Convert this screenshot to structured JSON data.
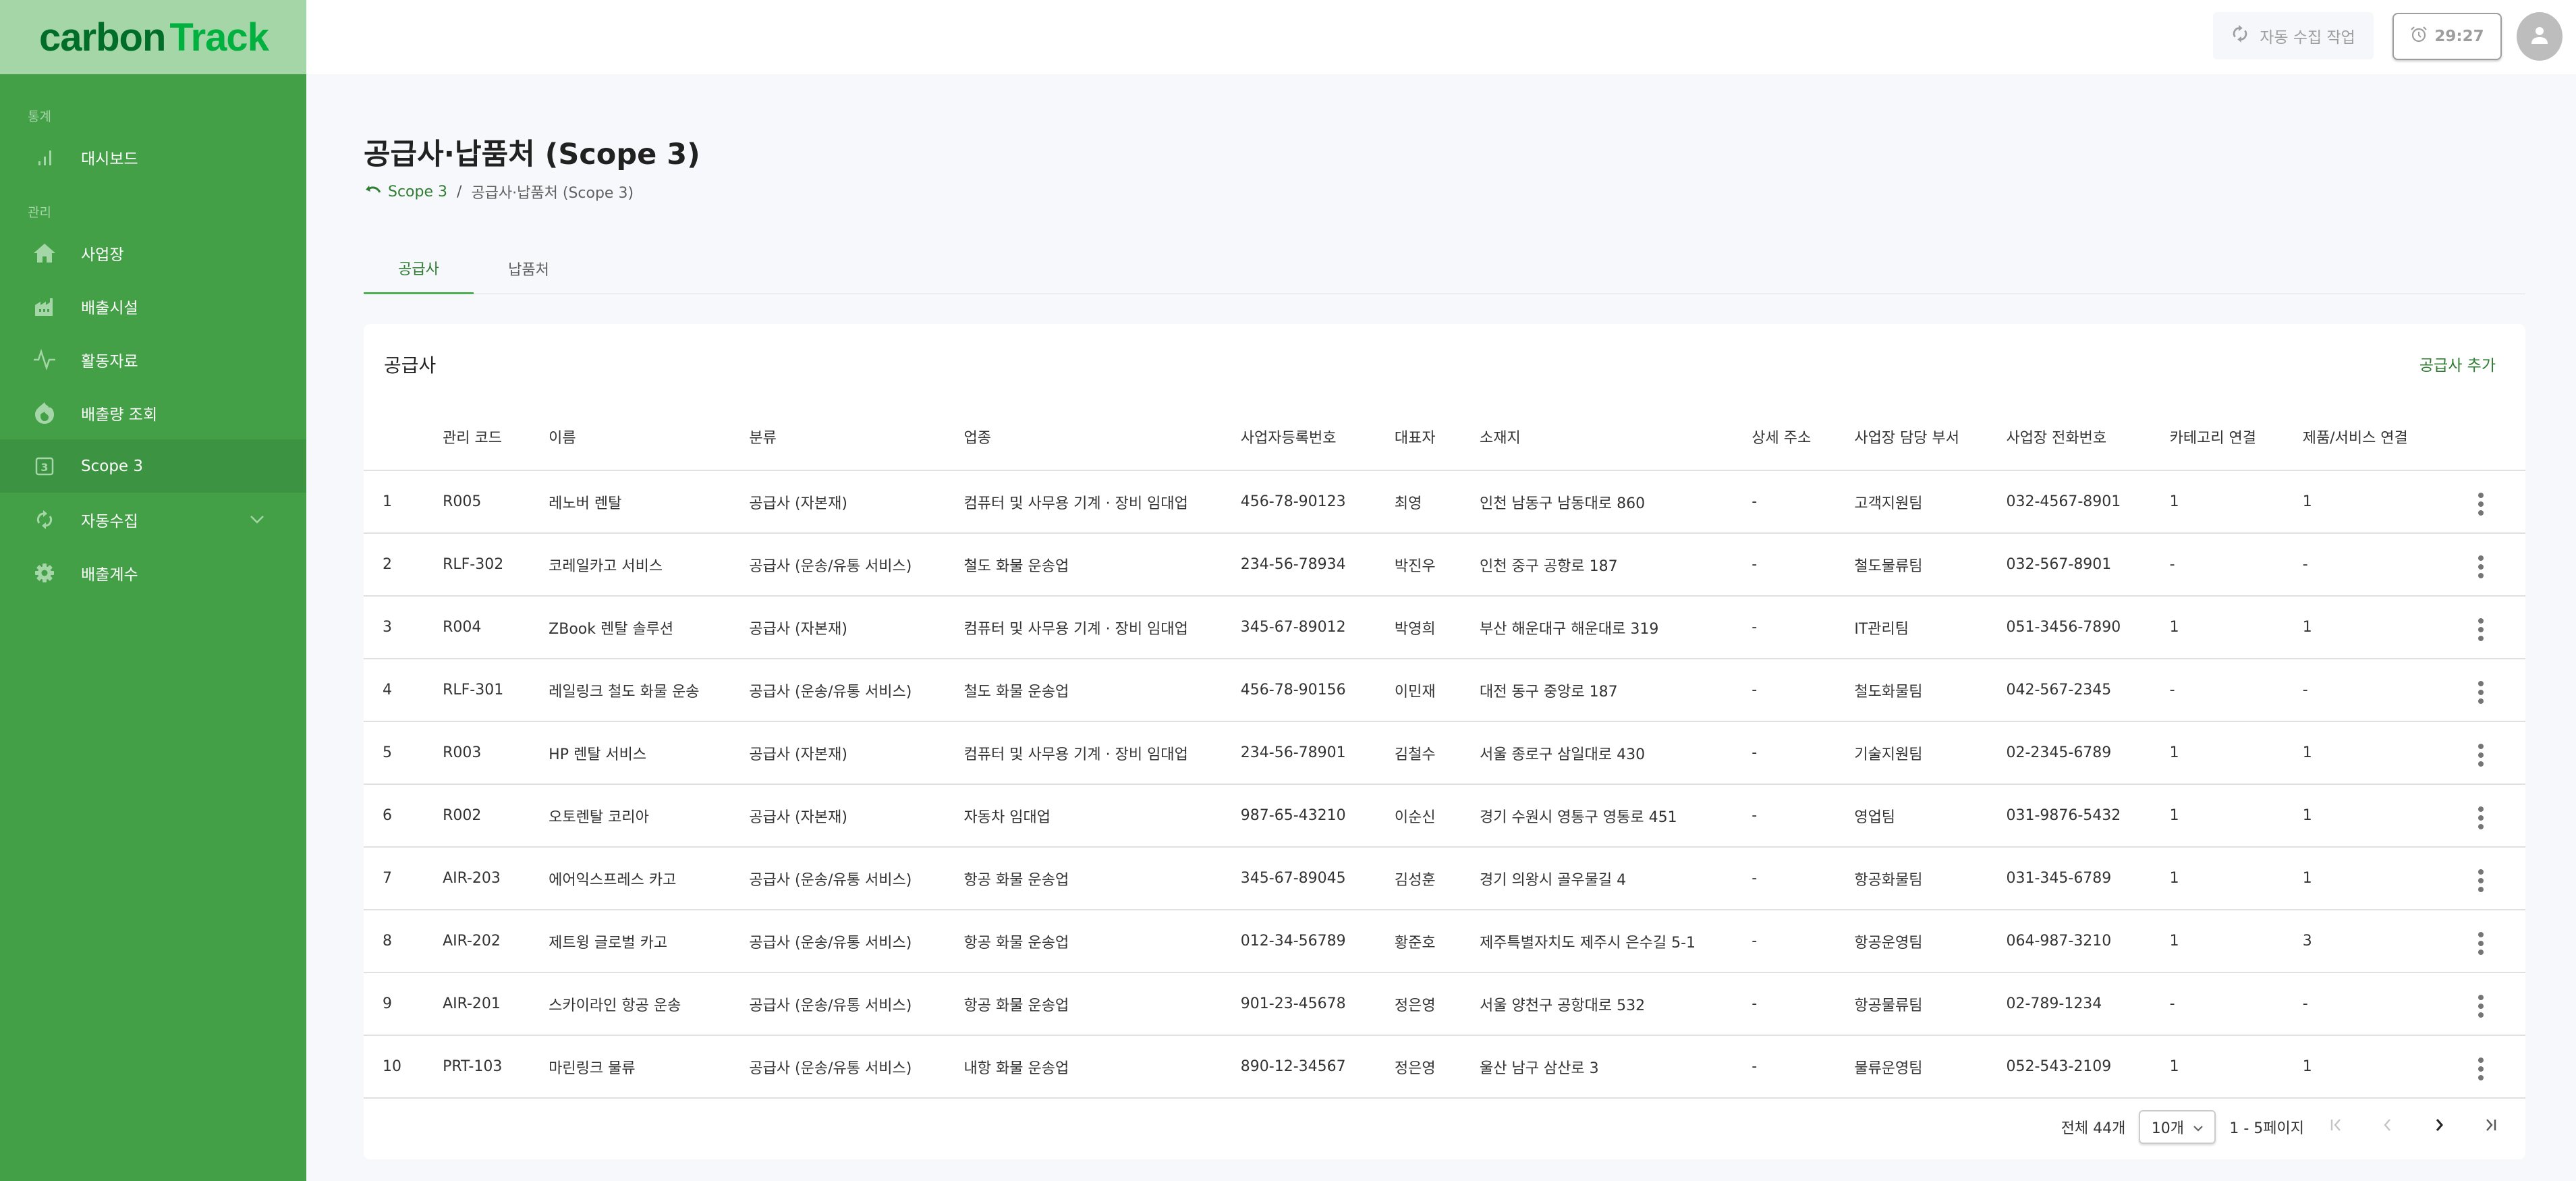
{
  "app": {
    "logo_part1": "carbon",
    "logo_part2": "Track"
  },
  "sidebar": {
    "sections": [
      {
        "label": "통계"
      },
      {
        "label": "관리"
      }
    ],
    "items": [
      {
        "label": "대시보드",
        "icon": "bar-chart-icon"
      },
      {
        "label": "사업장",
        "icon": "home-icon"
      },
      {
        "label": "배출시설",
        "icon": "factory-icon"
      },
      {
        "label": "활동자료",
        "icon": "activity-icon"
      },
      {
        "label": "배출량 조회",
        "icon": "fire-icon"
      },
      {
        "label": "Scope 3",
        "icon": "scope3-icon",
        "active": true
      },
      {
        "label": "자동수집",
        "icon": "sync-icon",
        "expandable": true
      },
      {
        "label": "배출계수",
        "icon": "gear-icon"
      }
    ]
  },
  "topbar": {
    "auto_collect_label": "자동 수집 작업",
    "timer": "29:27"
  },
  "page": {
    "title": "공급사·납품처 (Scope 3)",
    "breadcrumb_link": "Scope 3",
    "breadcrumb_sep": "/",
    "breadcrumb_current": "공급사·납품처 (Scope 3)",
    "tabs": [
      {
        "label": "공급사",
        "active": true
      },
      {
        "label": "납품처",
        "active": false
      }
    ]
  },
  "card": {
    "title": "공급사",
    "add_label": "공급사 추가"
  },
  "table": {
    "columns": [
      "",
      "관리 코드",
      "이름",
      "분류",
      "업종",
      "사업자등록번호",
      "대표자",
      "소재지",
      "상세 주소",
      "사업장 담당 부서",
      "사업장 전화번호",
      "카테고리 연결",
      "제품/서비스 연결",
      ""
    ],
    "rows": [
      [
        "1",
        "R005",
        "레노버 렌탈",
        "공급사 (자본재)",
        "컴퓨터 및 사무용 기계 · 장비 임대업",
        "456-78-90123",
        "최영",
        "인천 남동구 남동대로 860",
        "-",
        "고객지원팀",
        "032-4567-8901",
        "1",
        "1"
      ],
      [
        "2",
        "RLF-302",
        "코레일카고 서비스",
        "공급사 (운송/유통 서비스)",
        "철도 화물 운송업",
        "234-56-78934",
        "박진우",
        "인천 중구 공항로 187",
        "-",
        "철도물류팀",
        "032-567-8901",
        "-",
        "-"
      ],
      [
        "3",
        "R004",
        "ZBook 렌탈 솔루션",
        "공급사 (자본재)",
        "컴퓨터 및 사무용 기계 · 장비 임대업",
        "345-67-89012",
        "박영희",
        "부산 해운대구 해운대로 319",
        "-",
        "IT관리팀",
        "051-3456-7890",
        "1",
        "1"
      ],
      [
        "4",
        "RLF-301",
        "레일링크 철도 화물 운송",
        "공급사 (운송/유통 서비스)",
        "철도 화물 운송업",
        "456-78-90156",
        "이민재",
        "대전 동구 중앙로 187",
        "-",
        "철도화물팀",
        "042-567-2345",
        "-",
        "-"
      ],
      [
        "5",
        "R003",
        "HP 렌탈 서비스",
        "공급사 (자본재)",
        "컴퓨터 및 사무용 기계 · 장비 임대업",
        "234-56-78901",
        "김철수",
        "서울 종로구 삼일대로 430",
        "-",
        "기술지원팀",
        "02-2345-6789",
        "1",
        "1"
      ],
      [
        "6",
        "R002",
        "오토렌탈 코리아",
        "공급사 (자본재)",
        "자동차 임대업",
        "987-65-43210",
        "이순신",
        "경기 수원시 영통구 영통로 451",
        "-",
        "영업팀",
        "031-9876-5432",
        "1",
        "1"
      ],
      [
        "7",
        "AIR-203",
        "에어익스프레스 카고",
        "공급사 (운송/유통 서비스)",
        "항공 화물 운송업",
        "345-67-89045",
        "김성훈",
        "경기 의왕시 골우물길 4",
        "-",
        "항공화물팀",
        "031-345-6789",
        "1",
        "1"
      ],
      [
        "8",
        "AIR-202",
        "제트윙 글로벌 카고",
        "공급사 (운송/유통 서비스)",
        "항공 화물 운송업",
        "012-34-56789",
        "황준호",
        "제주특별자치도 제주시 은수길 5-1",
        "-",
        "항공운영팀",
        "064-987-3210",
        "1",
        "3"
      ],
      [
        "9",
        "AIR-201",
        "스카이라인 항공 운송",
        "공급사 (운송/유통 서비스)",
        "항공 화물 운송업",
        "901-23-45678",
        "정은영",
        "서울 양천구 공항대로 532",
        "-",
        "항공물류팀",
        "02-789-1234",
        "-",
        "-"
      ],
      [
        "10",
        "PRT-103",
        "마린링크 물류",
        "공급사 (운송/유통 서비스)",
        "내항 화물 운송업",
        "890-12-34567",
        "정은영",
        "울산 남구 삼산로 3",
        "-",
        "물류운영팀",
        "052-543-2109",
        "1",
        "1"
      ]
    ]
  },
  "pagination": {
    "total_label": "전체 44개",
    "page_size": "10개",
    "page_range": "1 - 5페이지"
  },
  "colors": {
    "sidebar_bg": "#43a047",
    "sidebar_active": "#3c9442",
    "logo_bg": "#a5d6a7",
    "accent": "#2e7d32",
    "tab_indicator": "#4caf50"
  }
}
